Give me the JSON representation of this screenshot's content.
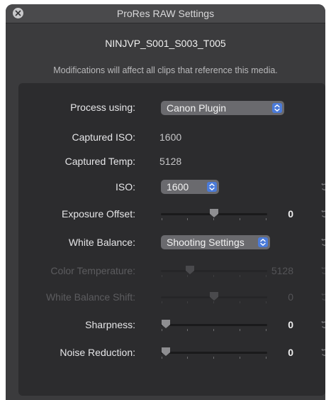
{
  "window": {
    "title": "ProRes RAW Settings",
    "clip_name": "NINJVP_S001_S003_T005",
    "notice": "Modifications will affect all clips that reference this media."
  },
  "settings": {
    "process_using": {
      "label": "Process using:",
      "value": "Canon Plugin"
    },
    "captured_iso": {
      "label": "Captured ISO:",
      "value": "1600"
    },
    "captured_temp": {
      "label": "Captured Temp:",
      "value": "5128"
    },
    "iso": {
      "label": "ISO:",
      "value": "1600"
    },
    "exposure_offset": {
      "label": "Exposure Offset:",
      "value": "0",
      "slider_position": 0.5,
      "enabled": true
    },
    "white_balance": {
      "label": "White Balance:",
      "value": "Shooting Settings"
    },
    "color_temperature": {
      "label": "Color Temperature:",
      "value": "5128",
      "slider_position": 0.25,
      "enabled": false
    },
    "white_balance_shift": {
      "label": "White Balance Shift:",
      "value": "0",
      "slider_position": 0.5,
      "enabled": false
    },
    "sharpness": {
      "label": "Sharpness:",
      "value": "0",
      "slider_position": 0.0,
      "enabled": true
    },
    "noise_reduction": {
      "label": "Noise Reduction:",
      "value": "0",
      "slider_position": 0.0,
      "enabled": true
    }
  },
  "icons": {
    "close": "close-icon",
    "popup_arrows": "up-down-chevrons-icon",
    "reset": "reset-arrow-icon"
  },
  "colors": {
    "window_bg": "#3b3b3d",
    "panel_bg": "#2c2c2e",
    "popup_bg": "#6a6a6e",
    "accent": "#4b7bd9",
    "disabled_text": "#5c5c5f"
  }
}
